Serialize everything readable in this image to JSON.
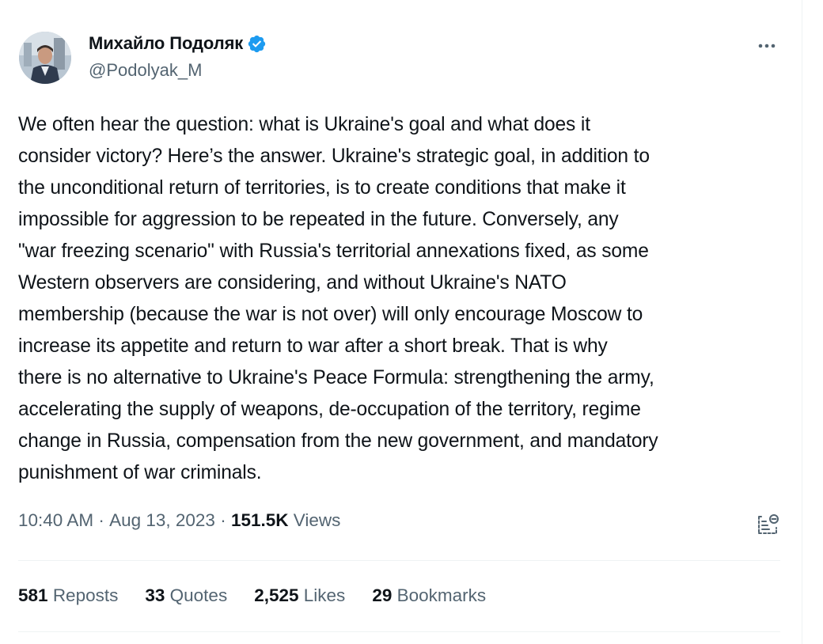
{
  "author": {
    "display_name": "Михайло Подоляк",
    "handle": "@Podolyak_M"
  },
  "tweet": {
    "text": "We often hear the question: what is Ukraine's goal and what does it\nconsider victory? Here’s the answer. Ukraine's strategic goal, in addition to\nthe unconditional return of territories, is to create conditions that make it\nimpossible for aggression to be repeated in the future. Conversely, any\n\"war freezing scenario\" with Russia's territorial annexations fixed, as some\nWestern observers are considering, and without Ukraine's NATO\nmembership (because the war is not over) will only encourage Moscow to\nincrease its appetite and return to war after a short break. That is why\nthere is no alternative to Ukraine's Peace Formula: strengthening the army,\naccelerating the supply of weapons, de-occupation of the territory, regime\nchange in Russia, compensation from the new government, and mandatory\npunishment of war criminals."
  },
  "meta": {
    "time": "10:40 AM",
    "separator": " · ",
    "date": "Aug 13, 2023",
    "views_count": "151.5K",
    "views_label": "Views"
  },
  "stats": {
    "reposts_count": "581",
    "reposts_label": "Reposts",
    "quotes_count": "33",
    "quotes_label": "Quotes",
    "likes_count": "2,525",
    "likes_label": "Likes",
    "bookmarks_count": "29",
    "bookmarks_label": "Bookmarks"
  },
  "icons": {
    "verified": "verified-badge-icon",
    "more": "more-icon",
    "analytics": "analytics-icon"
  },
  "colors": {
    "verified_blue": "#1d9bf0",
    "secondary_text": "#536471",
    "primary_text": "#0f1419",
    "divider": "#eff3f4"
  }
}
